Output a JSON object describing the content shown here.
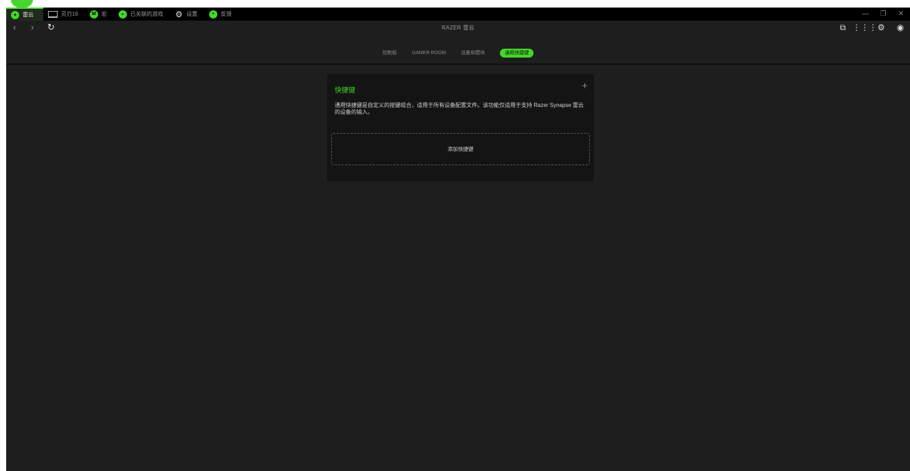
{
  "tabs": [
    {
      "label": "雷云",
      "icon": "razer-logo-icon"
    },
    {
      "label": "灵刃16",
      "icon": "laptop-icon"
    },
    {
      "label": "宏",
      "icon": "macro-icon"
    },
    {
      "label": "已关联的游戏",
      "icon": "gamepad-icon"
    },
    {
      "label": "设置",
      "icon": "gear-icon"
    },
    {
      "label": "反馈",
      "icon": "feedback-icon"
    }
  ],
  "nav": {
    "back": "‹",
    "forward": "›",
    "refresh": "↻"
  },
  "app_title": "RAZER 雷云",
  "subtabs": [
    "控制板",
    "GAMER ROOM",
    "设备和模块",
    "通用快捷键"
  ],
  "shortcuts": {
    "title": "快捷键",
    "add_icon": "+",
    "description": "通用快捷键是自定义的按键组合，适用于所有设备配置文件。该功能仅适用于支持 Razer Synapse 雷云 的设备的输入。",
    "add_label": "添加快捷键"
  },
  "colors": {
    "accent": "#44d62c",
    "background": "#1e1e1e",
    "card": "#141414"
  }
}
